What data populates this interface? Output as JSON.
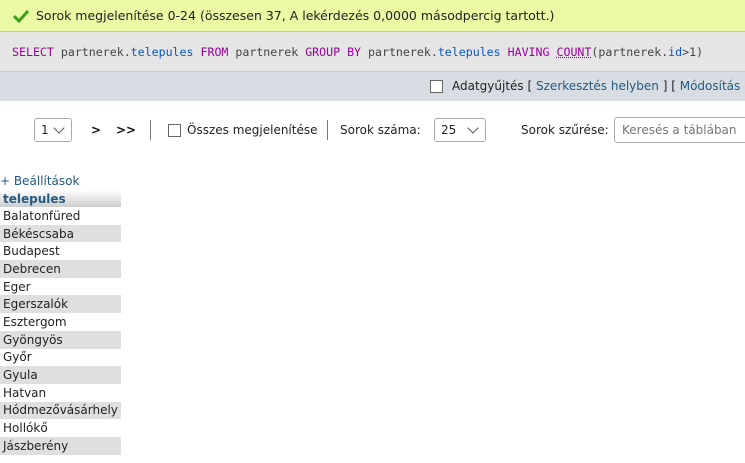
{
  "success": {
    "icon": "check-icon",
    "message": "Sorok megjelenítése 0-24 (összesen 37, A lekérdezés 0,0000 másodpercig tartott.)"
  },
  "sql": {
    "t1": "SELECT",
    "t2": " partnerek.",
    "t3": "telepules",
    "t4": " FROM",
    "t5": " partnerek ",
    "t6": "GROUP BY",
    "t7": " partnerek.",
    "t8": "telepules",
    "t9": " HAVING ",
    "t10": "COUNT",
    "t11": "(partnerek.",
    "t12": "id",
    "t13": ">1)"
  },
  "tools": {
    "profiling_label": "Adatgyűjtés",
    "bracket_open": "[",
    "inline_edit": "Szerkesztés helyben",
    "sep": "] [",
    "edit": "Módosítás",
    "bracket_close": "] [",
    "profiling_checked": false
  },
  "nav": {
    "page_value": "1",
    "next": ">",
    "last": ">>",
    "show_all_label": "Összes megjelenítése",
    "rows_label": "Sorok száma:",
    "rows_value": "25",
    "filter_label": "Sorok szűrése:",
    "filter_placeholder": "Keresés a táblában"
  },
  "options_link": "+ Beállítások",
  "table": {
    "header": "telepules",
    "rows": [
      "Balatonfüred",
      "Békéscsaba",
      "Budapest",
      "Debrecen",
      "Eger",
      "Egerszalók",
      "Esztergom",
      "Gyöngyös",
      "Győr",
      "Gyula",
      "Hatvan",
      "Hódmezővásárhely",
      "Hollókő",
      "Jászberény"
    ]
  }
}
